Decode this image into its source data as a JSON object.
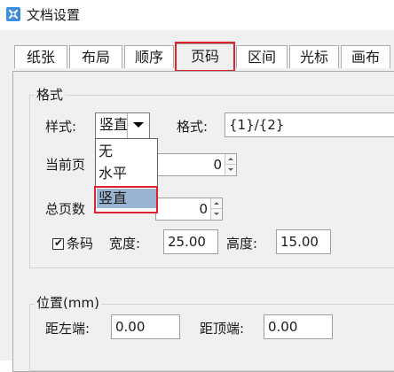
{
  "window": {
    "title": "文档设置",
    "icon": "app-settings-icon"
  },
  "tabs": [
    {
      "label": "纸张",
      "active": false
    },
    {
      "label": "布局",
      "active": false
    },
    {
      "label": "顺序",
      "active": false
    },
    {
      "label": "页码",
      "active": true
    },
    {
      "label": "区间",
      "active": false
    },
    {
      "label": "光标",
      "active": false
    },
    {
      "label": "画布",
      "active": false
    }
  ],
  "format_group": {
    "legend": "格式",
    "style_label": "样式:",
    "style_value": "竖直",
    "format_label": "格式:",
    "format_value": "{1}/{2}",
    "current_page_label": "当前页",
    "current_page_value": "0",
    "total_pages_label": "总页数",
    "total_pages_value": "0",
    "barcode_label": "条码",
    "barcode_checked": true,
    "width_label": "宽度:",
    "width_value": "25.00",
    "height_label": "高度:",
    "height_value": "15.00"
  },
  "style_dropdown": {
    "options": [
      "无",
      "水平",
      "竖直"
    ],
    "selected": "竖直"
  },
  "position_group": {
    "legend": "位置(mm)",
    "left_label": "距左端:",
    "left_value": "0.00",
    "top_label": "距顶端:",
    "top_value": "0.00"
  },
  "colors": {
    "highlight": "#e0212e",
    "selection": "#99b4d1",
    "dialog_bg": "#f0f0f0"
  }
}
